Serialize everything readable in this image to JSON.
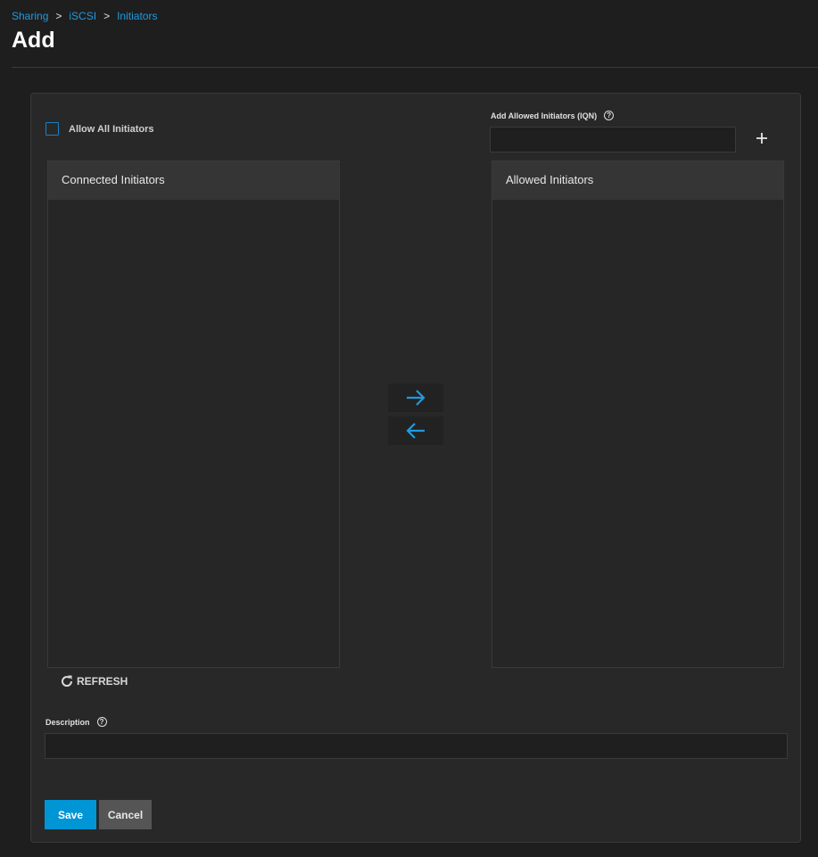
{
  "breadcrumb": {
    "items": [
      "Sharing",
      "iSCSI",
      "Initiators"
    ],
    "separator": ">"
  },
  "page": {
    "title": "Add"
  },
  "form": {
    "allow_all_label": "Allow All Initiators",
    "allow_all_checked": false,
    "iqn_label": "Add Allowed Initiators (IQN)",
    "iqn_value": "",
    "help_icon_glyph": "?",
    "add_icon": "plus-icon",
    "connected_header": "Connected Initiators",
    "allowed_header": "Allowed Initiators",
    "connected_items": [],
    "allowed_items": [],
    "refresh_label": "REFRESH",
    "description_label": "Description",
    "description_value": "",
    "save_label": "Save",
    "cancel_label": "Cancel"
  },
  "colors": {
    "accent": "#0095d5",
    "link": "#1e9be0",
    "background": "#1e1e1e",
    "card": "#282828"
  }
}
